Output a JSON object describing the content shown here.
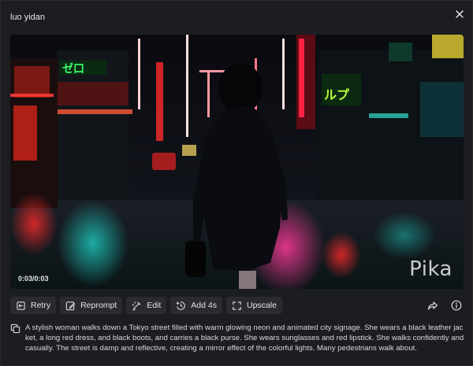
{
  "header": {
    "title": "luo yidan"
  },
  "video": {
    "timecode": "0:03/0:03",
    "watermark": "Pika"
  },
  "toolbar": {
    "retry_label": "Retry",
    "reprompt_label": "Reprompt",
    "edit_label": "Edit",
    "add4s_label": "Add 4s",
    "upscale_label": "Upscale"
  },
  "prompt": {
    "text": "A stylish woman walks down a Tokyo street filled with warm glowing neon and animated city signage. She wears a black leather jacket, a long red dress, and black boots, and carries a black purse. She wears sunglasses and red lipstick. She walks confidently and casually. The street is damp and reflective, creating a mirror effect of the colorful lights. Many pedestrians walk about."
  },
  "colors": {
    "background": "#1c1d20",
    "button": "#2a2b2f",
    "text": "#e4e4e4"
  },
  "icons": [
    "close-icon",
    "retry-icon",
    "reprompt-icon",
    "edit-icon",
    "add-4s-icon",
    "upscale-icon",
    "share-icon",
    "info-icon",
    "copy-icon"
  ]
}
